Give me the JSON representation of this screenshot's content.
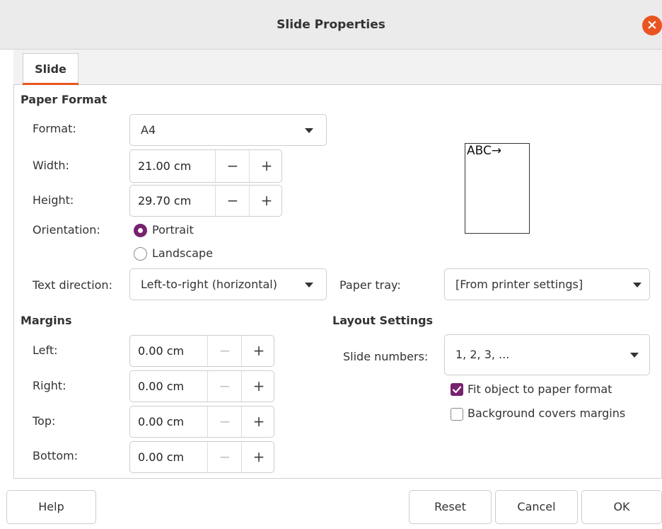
{
  "window": {
    "title": "Slide Properties"
  },
  "tabs": [
    {
      "label": "Slide"
    }
  ],
  "paper_format": {
    "heading": "Paper Format",
    "format_label": "Format:",
    "format_value": "A4",
    "width_label": "Width:",
    "width_value": "21.00 cm",
    "height_label": "Height:",
    "height_value": "29.70 cm",
    "orientation_label": "Orientation:",
    "portrait_label": "Portrait",
    "landscape_label": "Landscape",
    "orientation_selected": "Portrait",
    "text_direction_label": "Text direction:",
    "text_direction_value": "Left-to-right (horizontal)",
    "paper_tray_label": "Paper tray:",
    "paper_tray_value": "[From printer settings]",
    "preview_text": "ABC→"
  },
  "margins": {
    "heading": "Margins",
    "left_label": "Left:",
    "left_value": "0.00 cm",
    "right_label": "Right:",
    "right_value": "0.00 cm",
    "top_label": "Top:",
    "top_value": "0.00 cm",
    "bottom_label": "Bottom:",
    "bottom_value": "0.00 cm"
  },
  "layout": {
    "heading": "Layout Settings",
    "slide_numbers_label": "Slide numbers:",
    "slide_numbers_value": "1, 2, 3, ...",
    "fit_object_label": "Fit object to paper format",
    "fit_object_checked": true,
    "background_covers_label": "Background covers margins",
    "background_covers_checked": false
  },
  "buttons": {
    "help": "Help",
    "reset": "Reset",
    "cancel": "Cancel",
    "ok": "OK"
  },
  "spin_symbols": {
    "minus": "−",
    "plus": "+"
  },
  "colors": {
    "accent": "#e95420",
    "check": "#77216f"
  },
  "icons": {
    "close": "close-icon",
    "dropdown": "chevron-down-icon"
  }
}
